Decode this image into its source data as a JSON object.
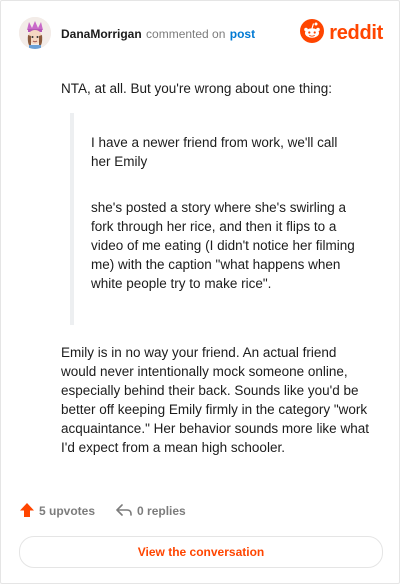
{
  "header": {
    "username": "DanaMorrigan",
    "action_text": "commented on",
    "post_link": "post",
    "brand_word": "reddit"
  },
  "comment": {
    "intro": "NTA, at all. But you're wrong about one thing:",
    "quote_para_1": "I have a newer friend from work, we'll call her Emily",
    "quote_para_2": "she's posted a story where she's swirling a fork through her rice, and then it flips to a video of me eating (I didn't notice her filming me) with the caption \"what happens when white people try to make rice\".",
    "body": "Emily is in no way your friend. An actual friend would never intentionally mock someone online, especially behind their back. Sounds like you'd be better off keeping Emily firmly in the category \"work acquaintance.\" Her behavior sounds more like what I'd expect from a mean high schooler."
  },
  "actions": {
    "upvotes_label": "5 upvotes",
    "replies_label": "0 replies"
  },
  "cta": {
    "label": "View the conversation"
  },
  "colors": {
    "brand": "#ff4500",
    "link": "#0079d3",
    "muted": "#7c7c7c"
  },
  "icons": [
    "avatar",
    "reddit-logo-icon",
    "upvote-arrow-icon",
    "reply-icon"
  ]
}
